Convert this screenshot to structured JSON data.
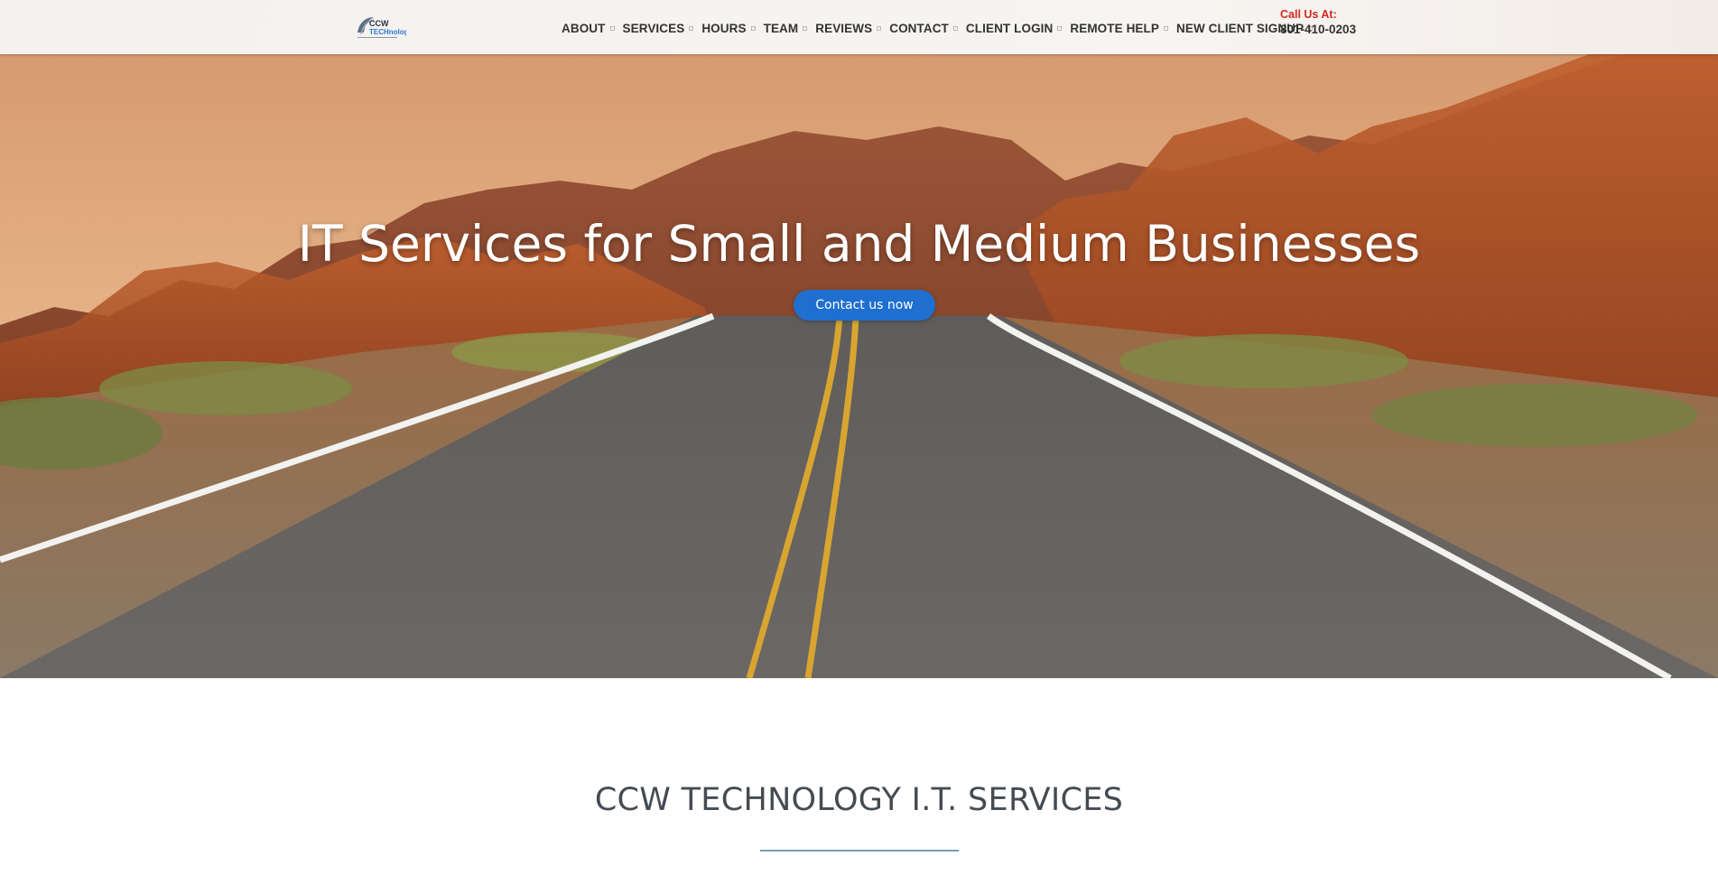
{
  "header": {
    "logo": {
      "name": "ccw-technology-logo",
      "text_top": "CCW",
      "text_bottom": "TECHnology"
    },
    "nav": [
      {
        "label": "ABOUT"
      },
      {
        "label": "SERVICES"
      },
      {
        "label": "HOURS"
      },
      {
        "label": "TEAM"
      },
      {
        "label": "REVIEWS"
      },
      {
        "label": "CONTACT"
      },
      {
        "label": "CLIENT LOGIN"
      },
      {
        "label": "REMOTE HELP"
      },
      {
        "label": "NEW CLIENT SIGNUP"
      }
    ],
    "call_label": "Call Us At:",
    "phone": "801-410-0203"
  },
  "hero": {
    "title": "IT Services for Small and Medium Businesses",
    "cta_label": "Contact us now",
    "image": "desert-road-red-rocks"
  },
  "section": {
    "title": "CCW TECHNOLOGY I.T. SERVICES"
  },
  "colors": {
    "accent_blue": "#1f6fd0",
    "call_red": "#d9261c",
    "nav_text": "#333333",
    "rule": "#6f9fb0"
  }
}
